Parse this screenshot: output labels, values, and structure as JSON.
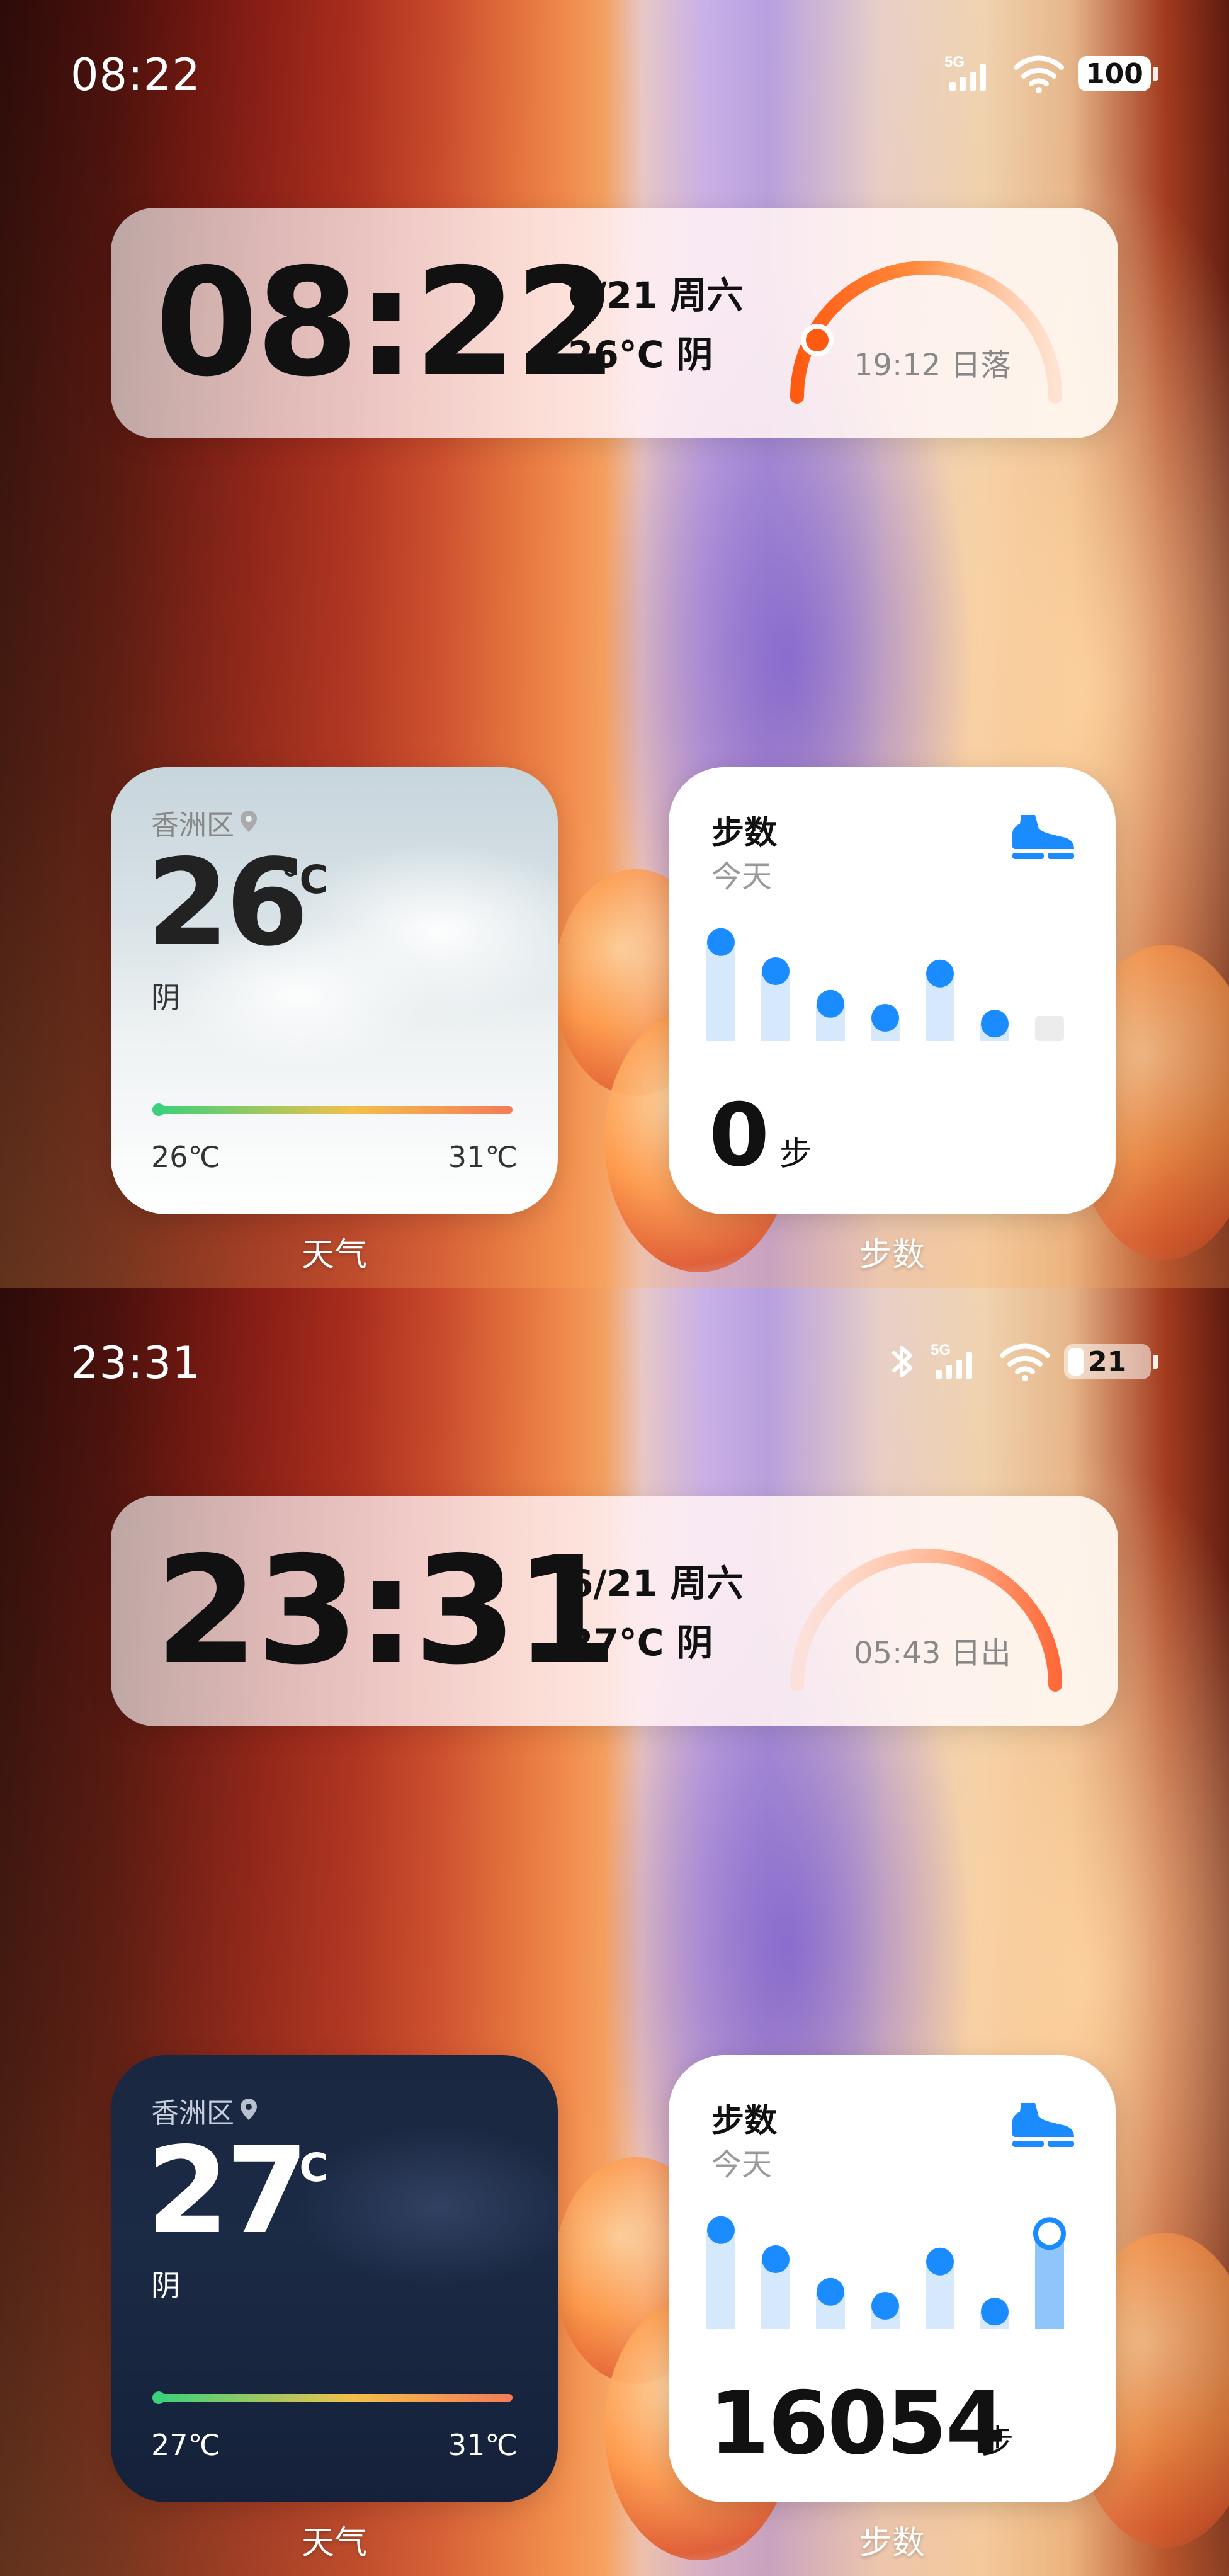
{
  "screens": [
    {
      "status": {
        "time": "08:22",
        "network": "5G",
        "battery": "100",
        "bluetooth": false
      },
      "clock": {
        "time": "08:22",
        "date": "6/21 周六",
        "weather": "26°C 阴",
        "sun_label": "19:12 日落",
        "sun_progress": 0.12
      },
      "weather": {
        "location": "香洲区",
        "temp": "26",
        "unit": "℃",
        "condition": "阴",
        "low": "26℃",
        "high": "31℃",
        "theme": "day"
      },
      "steps": {
        "title": "步数",
        "subtitle": "今天",
        "count": "0",
        "unit": "步",
        "bars": [
          0.85,
          0.6,
          0.32,
          0.2,
          0.58,
          0.15,
          0.0
        ],
        "current_bar_level": 0.0
      },
      "labels": {
        "weather": "天气",
        "steps": "步数"
      }
    },
    {
      "status": {
        "time": "23:31",
        "network": "5G",
        "battery": "21",
        "bluetooth": true
      },
      "clock": {
        "time": "23:31",
        "date": "6/21 周六",
        "weather": "27°C 阴",
        "sun_label": "05:43 日出",
        "sun_progress": 1.0
      },
      "weather": {
        "location": "香洲区",
        "temp": "27",
        "unit": "℃",
        "condition": "阴",
        "low": "27℃",
        "high": "31℃",
        "theme": "night"
      },
      "steps": {
        "title": "步数",
        "subtitle": "今天",
        "count": "16054",
        "unit": "步",
        "bars": [
          0.85,
          0.6,
          0.32,
          0.2,
          0.58,
          0.15,
          0.82
        ],
        "current_bar_level": 0.82
      },
      "labels": {
        "weather": "天气",
        "steps": "步数"
      }
    }
  ],
  "colors": {
    "accent_blue": "#1a8cff",
    "bar_light_blue": "#d6e8fb",
    "sun_orange": "#ff6a1a"
  }
}
